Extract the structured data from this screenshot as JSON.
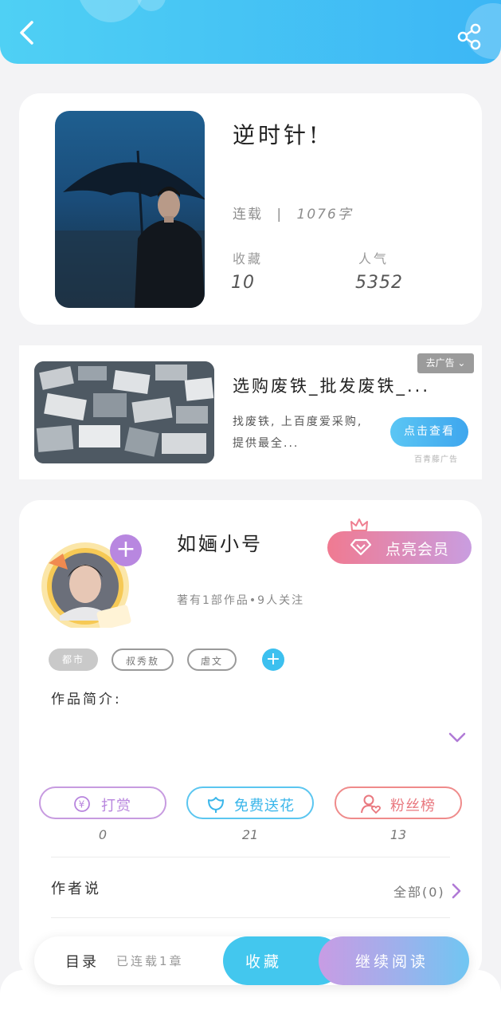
{
  "header": {
    "back_icon": "back-arrow-icon",
    "share_icon": "share-icon",
    "gradient": [
      "#4fd0f4",
      "#3cb6f5"
    ]
  },
  "book": {
    "title": "逆时针!",
    "status": "连载",
    "separator": "|",
    "word_count": "1076字",
    "favorites_label": "收藏",
    "favorites_count": "10",
    "popularity_label": "人气",
    "popularity_count": "5352"
  },
  "ad": {
    "tag": "去广告 ⌄",
    "title": "选购废铁_批发废铁_...",
    "description": "找废铁, 上百度爱采购, 提供最全...",
    "button": "点击查看",
    "source": "百青藤广告"
  },
  "author": {
    "name": "如婳小号",
    "meta": "著有1部作品•9人关注",
    "vip_button": "点亮会员",
    "tags": [
      "都市",
      "叔秀敖",
      "虐文"
    ],
    "intro_label": "作品简介:",
    "reward_label": "打赏",
    "reward_count": "0",
    "flower_label": "免费送花",
    "flower_count": "21",
    "fans_label": "粉丝榜",
    "fans_count": "13",
    "author_says": "作者说",
    "see_all": "全部(0)"
  },
  "bottom_bar": {
    "toc_label": "目录",
    "toc_status": "已连载1章",
    "favorite_button": "收藏",
    "continue_button": "继续阅读"
  },
  "colors": {
    "accent_blue": "#43c7ee",
    "vip_pink": "#f07a91",
    "vip_purple": "#c99de0",
    "reward_purple": "#c79be0",
    "flower_blue": "#5bc6f0",
    "fans_red": "#ef8b8b"
  }
}
